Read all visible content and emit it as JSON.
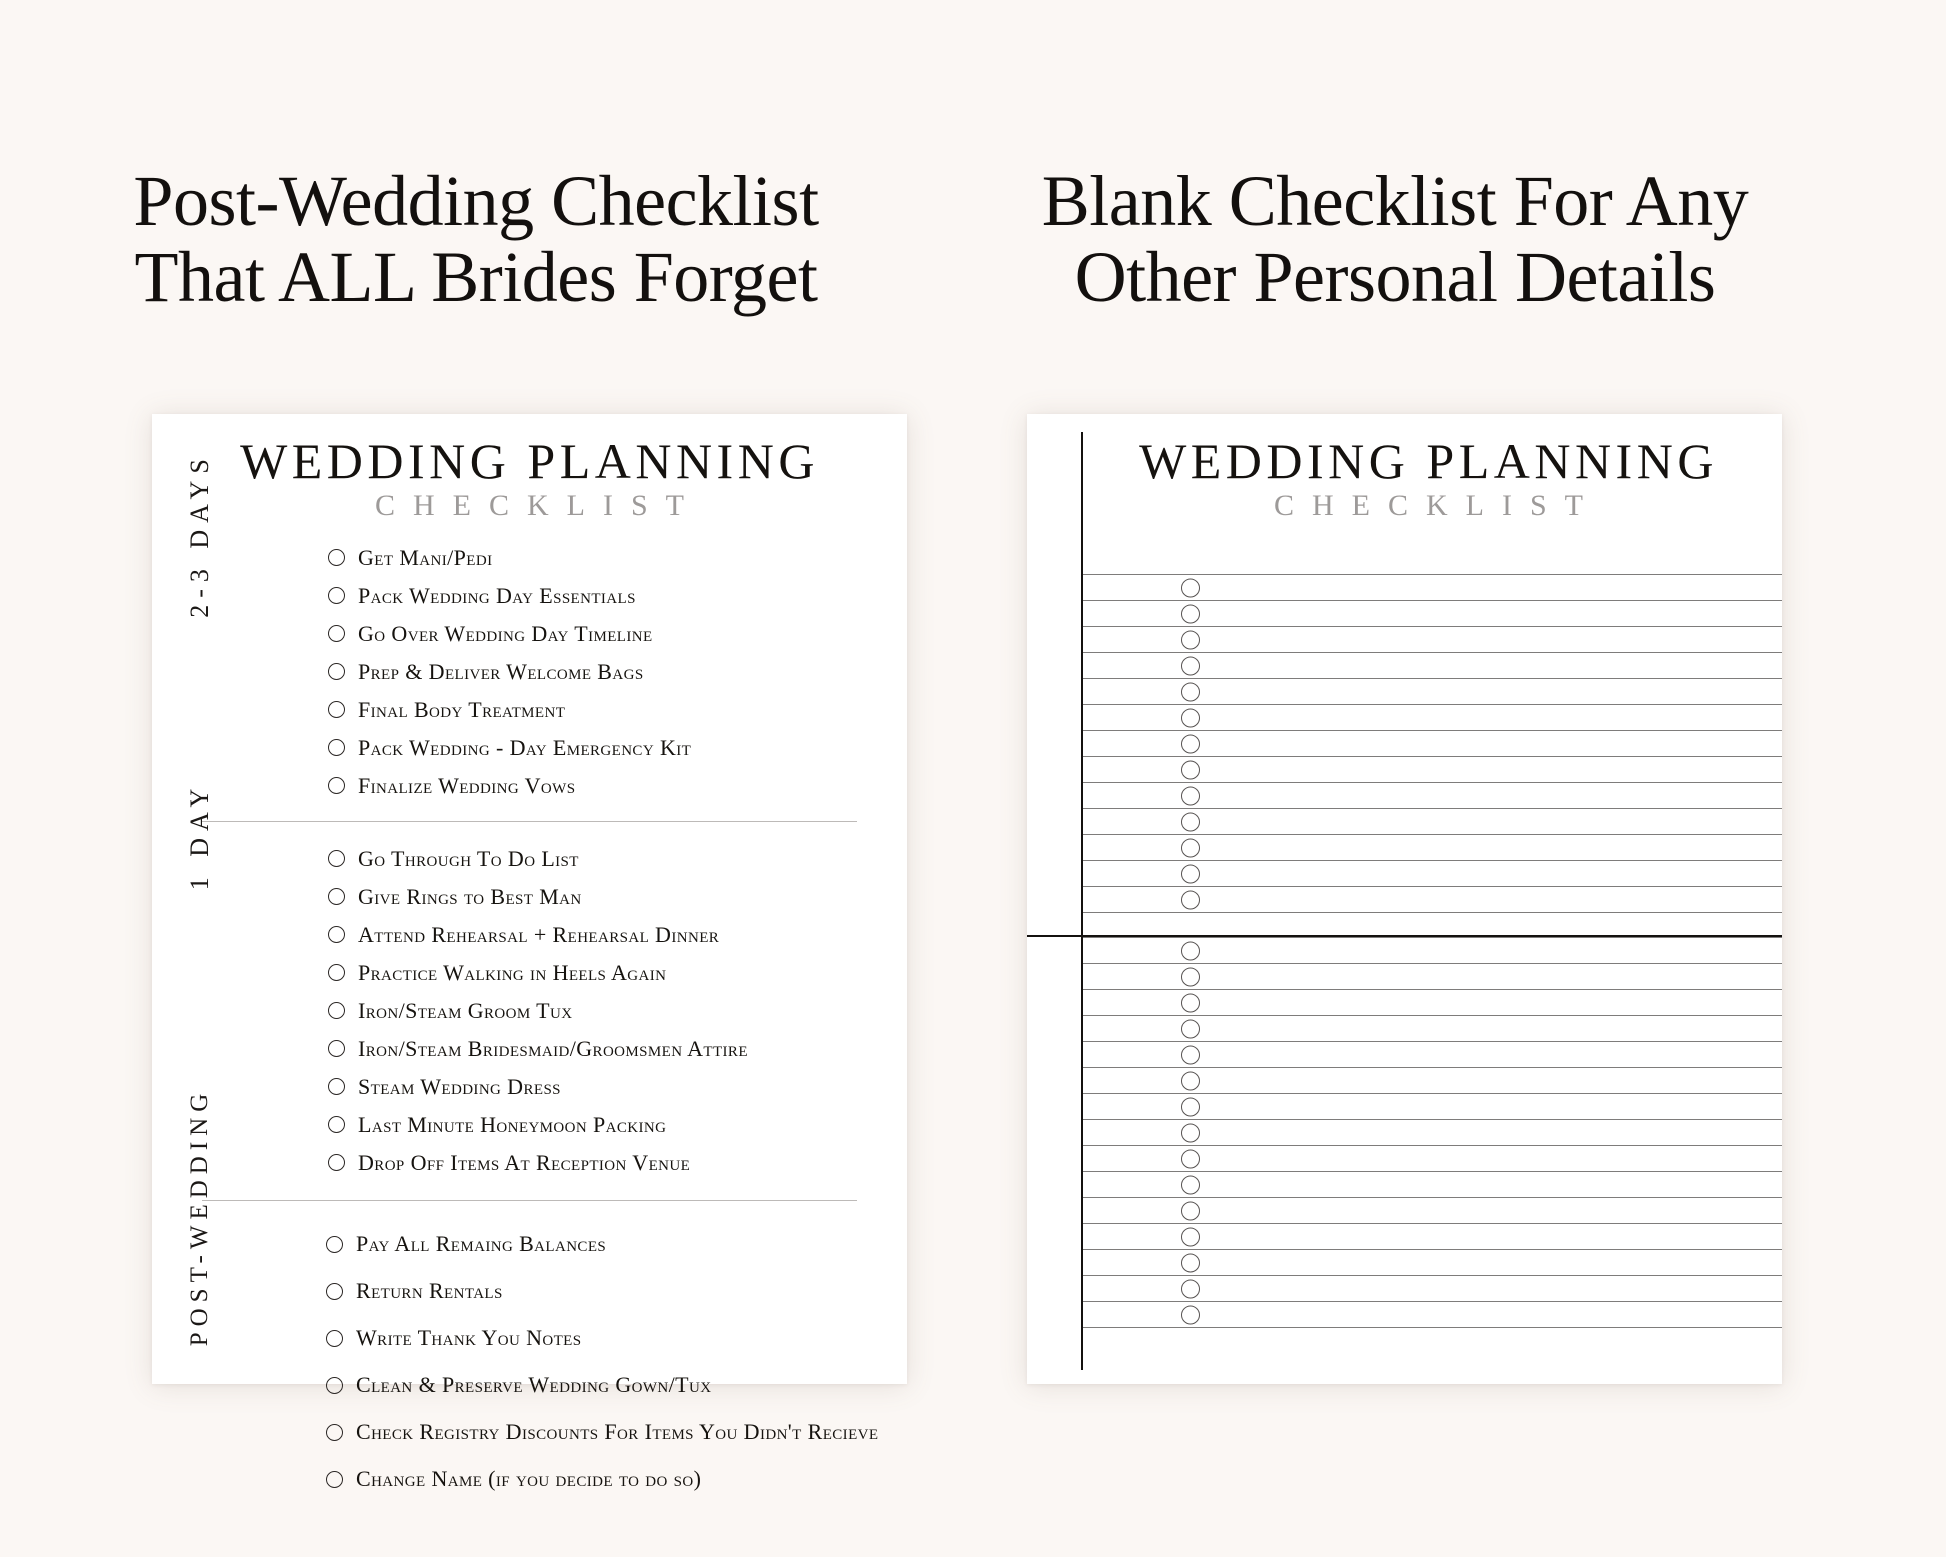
{
  "background_color": "#FBF7F4",
  "panels": [
    {
      "heading_lines": [
        "Post-Wedding Checklist",
        "That ALL Brides Forget"
      ],
      "card": {
        "title_main": "WEDDING PLANNING",
        "title_sub": "CHECKLIST",
        "sections": [
          {
            "label": "2-3  DAYS",
            "items": [
              "Get Mani/Pedi",
              "Pack Wedding Day Essentials",
              "Go Over Wedding Day Timeline",
              "Prep & Deliver Welcome Bags",
              "Final Body Treatment",
              "Pack Wedding - Day Emergency Kit",
              "Finalize Wedding  Vows"
            ]
          },
          {
            "label": "1  DAY",
            "items": [
              "Go Through To Do List",
              "Give Rings to Best Man",
              "Attend Rehearsal + Rehearsal Dinner",
              "Practice Walking in Heels Again",
              "Iron/Steam Groom Tux",
              "Iron/Steam Bridesmaid/Groomsmen Attire",
              "Steam Wedding Dress",
              "Last Minute Honeymoon Packing",
              "Drop Off Items At Reception Venue"
            ]
          },
          {
            "label": "POST-WEDDING",
            "items": [
              "Pay All Remaing Balances",
              "Return Rentals",
              "Write Thank You Notes",
              "Clean & Preserve Wedding Gown/Tux",
              "Check Registry Discounts For Items You Didn't Recieve",
              "Change Name (if you decide to do so)"
            ]
          }
        ]
      }
    },
    {
      "heading_lines": [
        "Blank Checklist For Any",
        "Other Personal Details"
      ],
      "card": {
        "title_main": "WEDDING PLANNING",
        "title_sub": "CHECKLIST",
        "blank_groups": [
          {
            "rows": 13
          },
          {
            "rows": 15
          }
        ]
      }
    }
  ]
}
